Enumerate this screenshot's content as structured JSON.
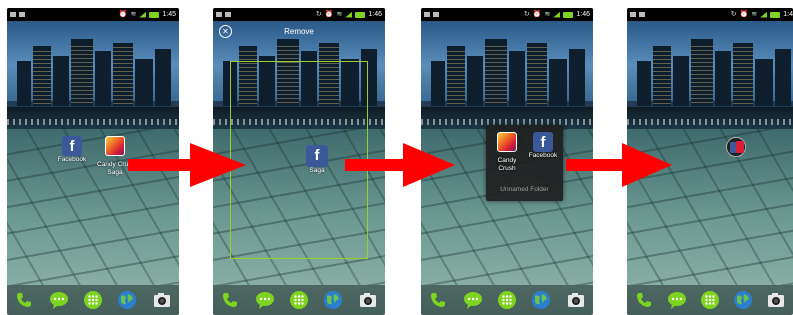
{
  "panels": [
    {
      "status_time": "1:45",
      "icons": [
        {
          "app": "facebook",
          "label": "Facebook"
        },
        {
          "app": "candy-crush",
          "label_lines": [
            "Candy Crush",
            "Saga"
          ]
        }
      ]
    },
    {
      "status_time": "1:46",
      "remove_label": "Remove",
      "dragging_label": "Saga"
    },
    {
      "status_time": "1:46",
      "folder": {
        "items": [
          {
            "app": "candy-crush",
            "label_lines": [
              "Candy",
              "Crush"
            ]
          },
          {
            "app": "facebook",
            "label": "Facebook"
          }
        ],
        "name": "Unnamed Folder"
      }
    },
    {
      "status_time": "1:4"
    }
  ],
  "dock_icons": [
    "phone-icon",
    "messaging-icon",
    "app-drawer-icon",
    "browser-globe-icon",
    "camera-icon"
  ],
  "colors": {
    "arrow": "#ff0000",
    "facebook": "#3b5998",
    "drop_frame": "#9acd32",
    "status_green": "#7ed321"
  }
}
